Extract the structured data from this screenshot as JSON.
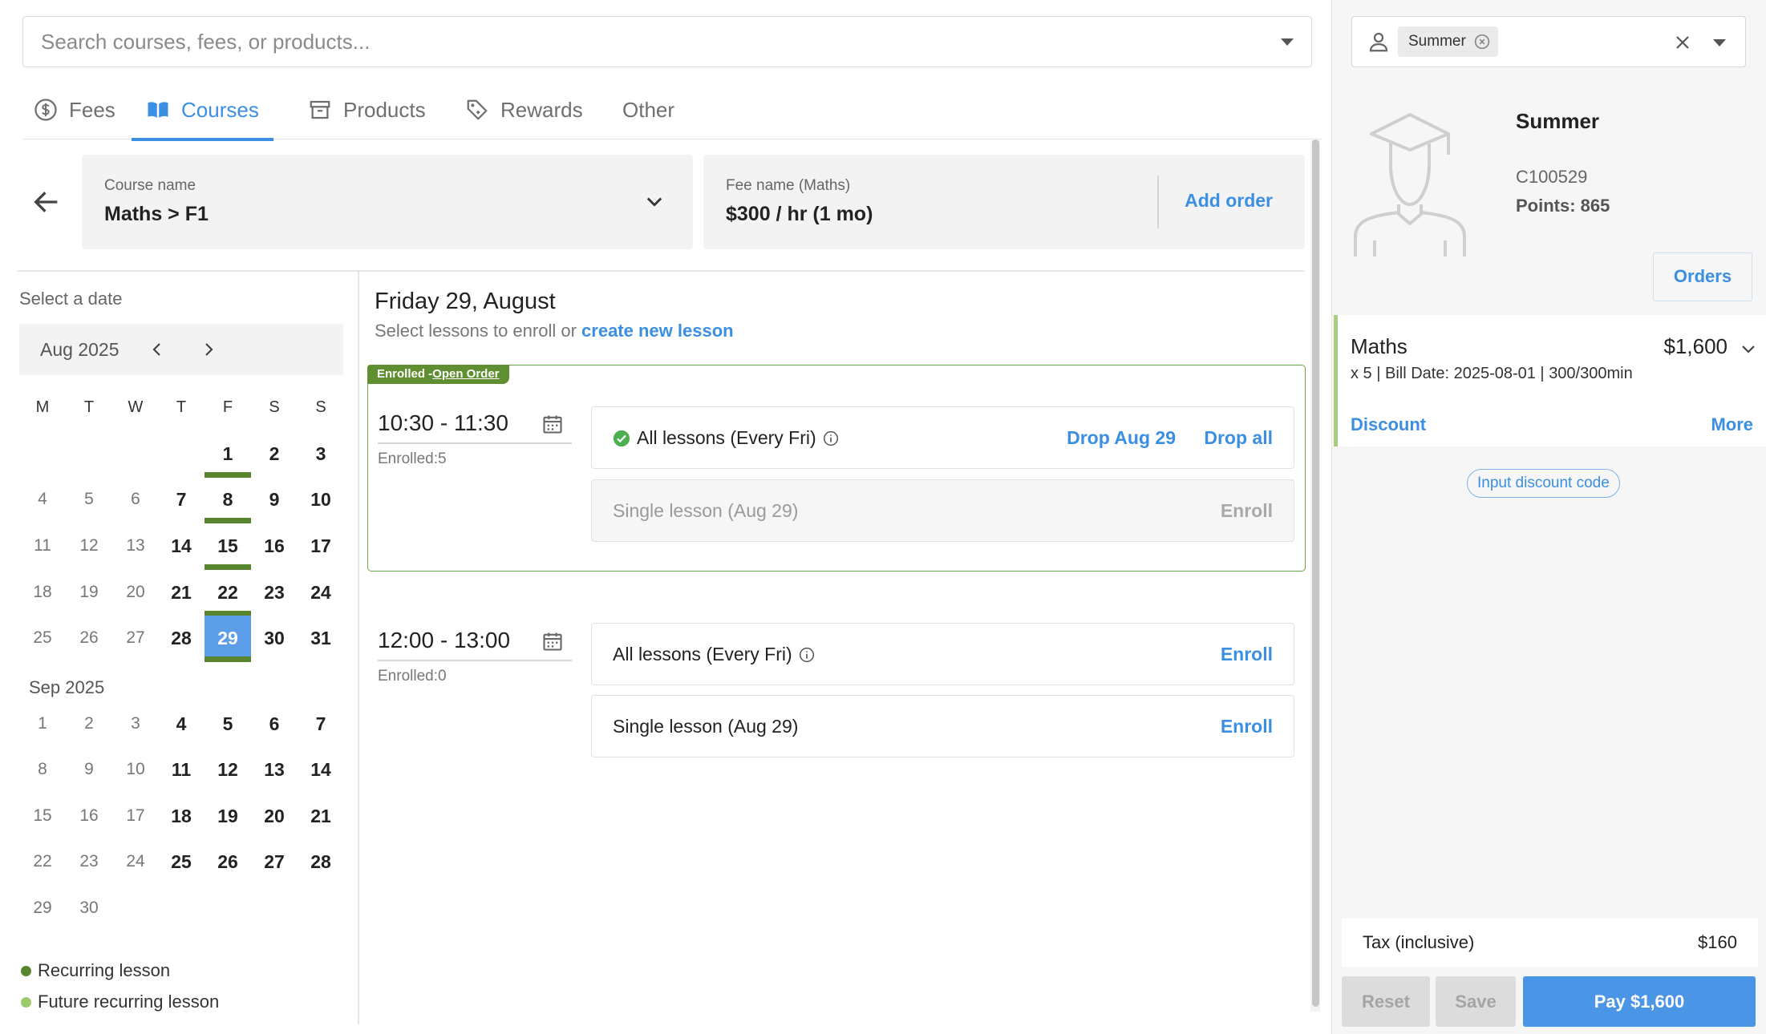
{
  "search": {
    "placeholder": "Search courses, fees, or products..."
  },
  "tabs": [
    {
      "label": "Fees",
      "icon": "dollar-circle-icon"
    },
    {
      "label": "Courses",
      "icon": "book-icon",
      "active": true
    },
    {
      "label": "Products",
      "icon": "archive-box-icon"
    },
    {
      "label": "Rewards",
      "icon": "tag-icon"
    },
    {
      "label": "Other"
    }
  ],
  "course": {
    "label": "Course name",
    "value": "Maths > F1"
  },
  "fee": {
    "label": "Fee name (Maths)",
    "value": "$300 / hr (1 mo)",
    "action": "Add order"
  },
  "calendar": {
    "title": "Select a date",
    "month_label": "Aug 2025",
    "next_month_label": "Sep 2025",
    "weekdays": [
      "M",
      "T",
      "W",
      "T",
      "F",
      "S",
      "S"
    ],
    "aug": [
      [
        "",
        "",
        "",
        "",
        "1",
        "2",
        "3"
      ],
      [
        "4",
        "5",
        "6",
        "7",
        "8",
        "9",
        "10"
      ],
      [
        "11",
        "12",
        "13",
        "14",
        "15",
        "16",
        "17"
      ],
      [
        "18",
        "19",
        "20",
        "21",
        "22",
        "23",
        "24"
      ],
      [
        "25",
        "26",
        "27",
        "28",
        "29",
        "30",
        "31"
      ]
    ],
    "sep": [
      [
        "1",
        "2",
        "3",
        "4",
        "5",
        "6",
        "7"
      ],
      [
        "8",
        "9",
        "10",
        "11",
        "12",
        "13",
        "14"
      ],
      [
        "15",
        "16",
        "17",
        "18",
        "19",
        "20",
        "21"
      ],
      [
        "22",
        "23",
        "24",
        "25",
        "26",
        "27",
        "28"
      ],
      [
        "29",
        "30",
        "",
        "",
        "",
        "",
        ""
      ]
    ],
    "selected_day": "29",
    "recurring_days": [
      "1",
      "8",
      "15",
      "22",
      "29"
    ]
  },
  "legend": [
    {
      "label": "Recurring lesson",
      "color": "#57862f"
    },
    {
      "label": "Future recurring lesson",
      "color": "#9ccc6a"
    }
  ],
  "day_panel": {
    "title": "Friday 29, August",
    "subtitle": "Select lessons to enroll or",
    "subtitle_link": "create new lesson",
    "open_tag": "Enrolled -",
    "open_tag_link": "Open Order",
    "slots": [
      {
        "time": "10:30 - 11:30",
        "enrolled": "Enrolled:5",
        "all": {
          "label": "All lessons (Every Fri)",
          "action1": "Drop Aug 29",
          "action2": "Drop all"
        },
        "single": {
          "label": "Single lesson (Aug 29)",
          "action": "Enroll"
        }
      },
      {
        "time": "12:00 - 13:00",
        "enrolled": "Enrolled:0",
        "all": {
          "label": "All lessons (Every Fri)",
          "action": "Enroll"
        },
        "single": {
          "label": "Single lesson (Aug 29)",
          "action": "Enroll"
        }
      }
    ]
  },
  "customer": {
    "chip": "Summer",
    "name": "Summer",
    "id": "C100529",
    "points": "Points: 865",
    "orders_label": "Orders"
  },
  "order": {
    "title": "Maths",
    "price": "$1,600",
    "desc": "x 5 | Bill Date: 2025-08-01 | 300/300min",
    "discount": "Discount",
    "more": "More"
  },
  "discount_code": "Input discount code",
  "tax": {
    "label": "Tax (inclusive)",
    "value": "$160"
  },
  "buttons": {
    "reset": "Reset",
    "save": "Save",
    "pay": "Pay $1,600"
  },
  "colors": {
    "accent": "#3b8fe3",
    "recurring": "#57862f",
    "selected": "#5b9de6"
  }
}
